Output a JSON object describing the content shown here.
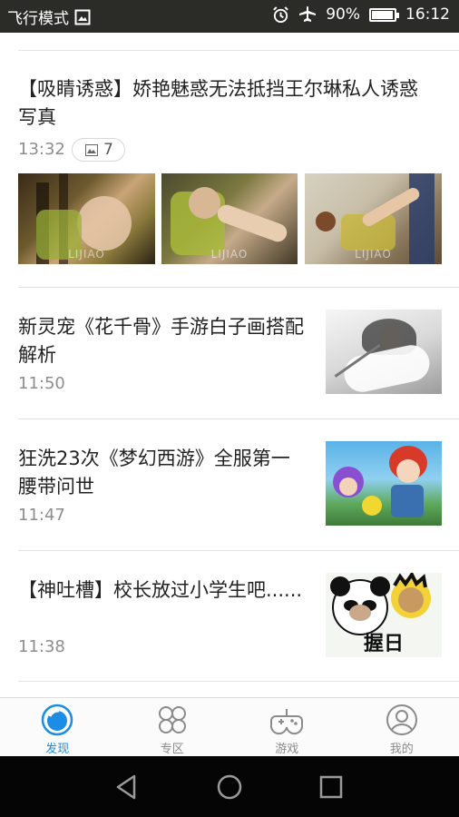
{
  "status_bar": {
    "airplane_mode_text": "飞行模式",
    "battery_percent": "90%",
    "battery_level": 0.9,
    "time": "16:12",
    "icons": [
      "screenshot-icon",
      "alarm-icon",
      "airplane-icon",
      "battery-icon"
    ]
  },
  "feed": {
    "items": [
      {
        "title": "【吸睛诱惑】娇艳魅惑无法抵挡王尔琳私人诱惑写真",
        "time": "13:32",
        "image_count": "7",
        "watermark": "LIJIAO",
        "type": "gallery"
      },
      {
        "title": "新灵宠《花千骨》手游白子画搭配解析",
        "time": "11:50",
        "type": "single"
      },
      {
        "title": "狂洗23次《梦幻西游》全服第一腰带问世",
        "time": "11:47",
        "type": "single"
      },
      {
        "title": "【神吐槽】校长放过小学生吧......",
        "time": "11:38",
        "thumb_text": "握日",
        "type": "single"
      }
    ]
  },
  "tabbar": {
    "tabs": [
      {
        "label": "发现",
        "icon": "discover-icon",
        "active": true
      },
      {
        "label": "专区",
        "icon": "zone-icon",
        "active": false
      },
      {
        "label": "游戏",
        "icon": "gamepad-icon",
        "active": false
      },
      {
        "label": "我的",
        "icon": "profile-icon",
        "active": false
      }
    ]
  },
  "colors": {
    "accent": "#1c8de4",
    "status_bar": "#2b2b28",
    "nav_bar": "#050505"
  }
}
